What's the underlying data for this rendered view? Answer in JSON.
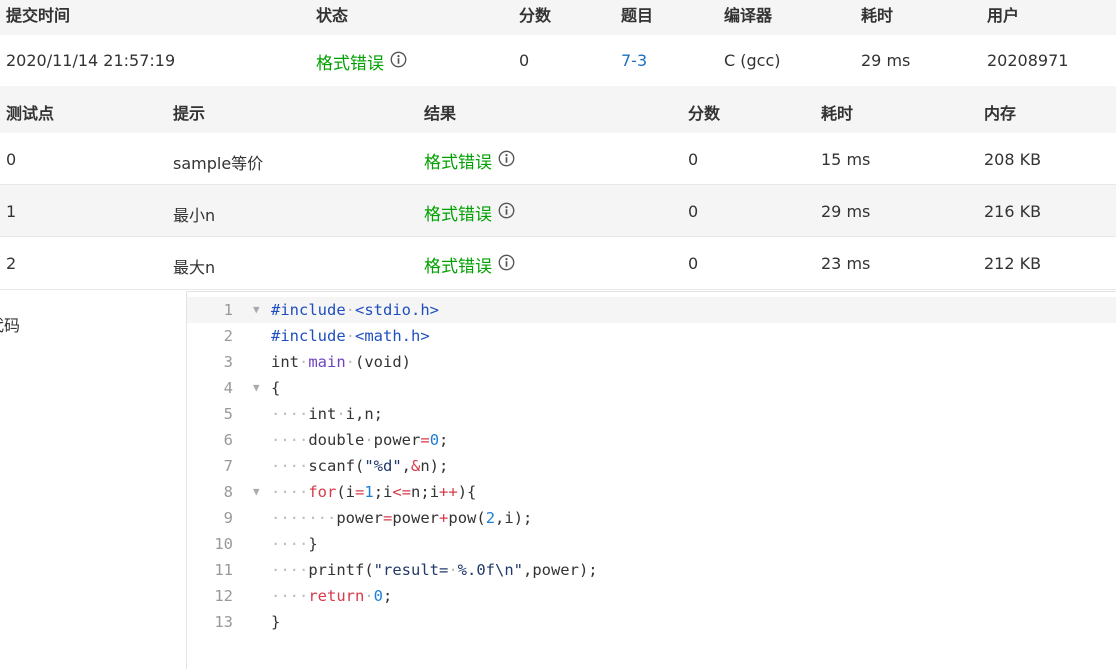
{
  "submission": {
    "headers": [
      "提交时间",
      "状态",
      "分数",
      "题目",
      "编译器",
      "耗时",
      "用户"
    ],
    "row": {
      "time": "2020/11/14 21:57:19",
      "status": "格式错误",
      "score": "0",
      "problem": "7-3",
      "compiler": "C (gcc)",
      "elapsed": "29 ms",
      "user": "20208971"
    }
  },
  "testcases": {
    "headers": [
      "测试点",
      "提示",
      "结果",
      "分数",
      "耗时",
      "内存"
    ],
    "rows": [
      {
        "id": "0",
        "hint": "sample等价",
        "result": "格式错误",
        "score": "0",
        "time": "15 ms",
        "memory": "208 KB"
      },
      {
        "id": "1",
        "hint": "最小n",
        "result": "格式错误",
        "score": "0",
        "time": "29 ms",
        "memory": "216 KB"
      },
      {
        "id": "2",
        "hint": "最大n",
        "result": "格式错误",
        "score": "0",
        "time": "23 ms",
        "memory": "212 KB"
      }
    ]
  },
  "code_section": {
    "label": "代码",
    "line_numbers": [
      "1",
      "2",
      "3",
      "4",
      "5",
      "6",
      "7",
      "8",
      "9",
      "10",
      "11",
      "12",
      "13"
    ]
  },
  "colors": {
    "status_green": "#00a000",
    "link_blue": "#1f6fc4",
    "header_bg": "#f5f5f5"
  },
  "icons": {
    "status_info": "info-circle-icon",
    "fold": "fold-arrow-icon"
  }
}
